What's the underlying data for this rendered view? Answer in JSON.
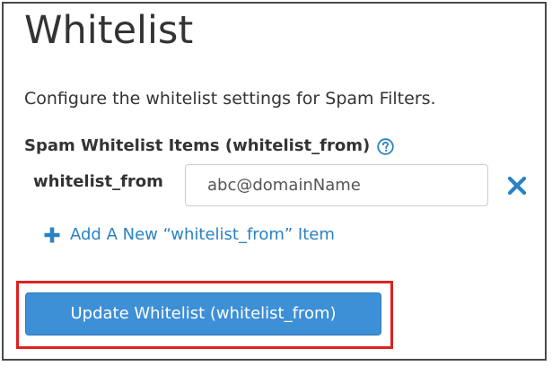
{
  "page": {
    "title": "Whitelist",
    "description": "Configure the whitelist settings for Spam Filters."
  },
  "section": {
    "label": "Spam Whitelist Items (whitelist_from)",
    "help_icon": "question-circle-icon"
  },
  "item": {
    "label": "whitelist_from",
    "value": "abc@domainName",
    "remove_icon": "close-x-icon"
  },
  "add_link": {
    "icon": "plus-icon",
    "label": "Add A New “whitelist_from” Item"
  },
  "update_button": {
    "label": "Update Whitelist (whitelist_from)"
  },
  "colors": {
    "accent": "#2a82c3",
    "button_bg": "#3d8fd6",
    "highlight": "#e02020",
    "text": "#333333"
  }
}
